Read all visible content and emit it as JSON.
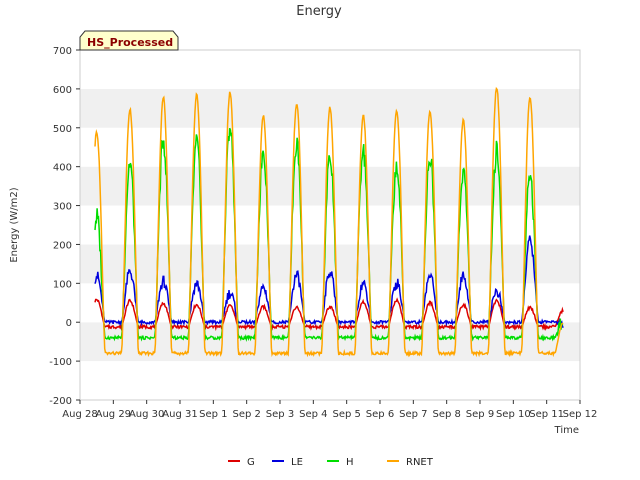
{
  "chart_data": {
    "type": "line",
    "title": "Energy",
    "badge": "HS_Processed",
    "xlabel": "Time",
    "ylabel": "Energy (W/m2)",
    "ylim": [
      -200,
      700
    ],
    "yticks": [
      -200,
      -100,
      0,
      100,
      200,
      300,
      400,
      500,
      600,
      700
    ],
    "xticks": [
      "Aug 28",
      "Aug 29",
      "Aug 30",
      "Aug 31",
      "Sep 1",
      "Sep 2",
      "Sep 3",
      "Sep 4",
      "Sep 5",
      "Sep 6",
      "Sep 7",
      "Sep 8",
      "Sep 9",
      "Sep 10",
      "Sep 11",
      "Sep 12"
    ],
    "xlim_days": [
      0,
      15
    ],
    "days": [
      "Aug 28",
      "Aug 29",
      "Aug 30",
      "Aug 31",
      "Sep 1",
      "Sep 2",
      "Sep 3",
      "Sep 4",
      "Sep 5",
      "Sep 6",
      "Sep 7",
      "Sep 8",
      "Sep 9",
      "Sep 10",
      "Sep 11"
    ],
    "grid": "horizontal bands",
    "legend_position": "bottom",
    "series": [
      {
        "name": "G",
        "color": "#dd0000",
        "night": -12,
        "peaks": [
          58,
          55,
          48,
          45,
          42,
          40,
          38,
          40,
          52,
          55,
          50,
          45,
          55,
          38,
          30
        ]
      },
      {
        "name": "LE",
        "color": "#0000dd",
        "night": 0,
        "peaks": [
          120,
          130,
          105,
          100,
          75,
          90,
          120,
          130,
          100,
          100,
          120,
          120,
          80,
          210,
          0
        ]
      },
      {
        "name": "H",
        "color": "#00dd00",
        "night": -40,
        "peaks": [
          270,
          410,
          470,
          460,
          505,
          445,
          460,
          425,
          440,
          400,
          430,
          390,
          440,
          380,
          0
        ]
      },
      {
        "name": "RNET",
        "color": "#ffa500",
        "night": -80,
        "peaks": [
          490,
          548,
          580,
          585,
          590,
          533,
          563,
          553,
          533,
          545,
          543,
          520,
          605,
          580,
          0
        ]
      }
    ]
  }
}
